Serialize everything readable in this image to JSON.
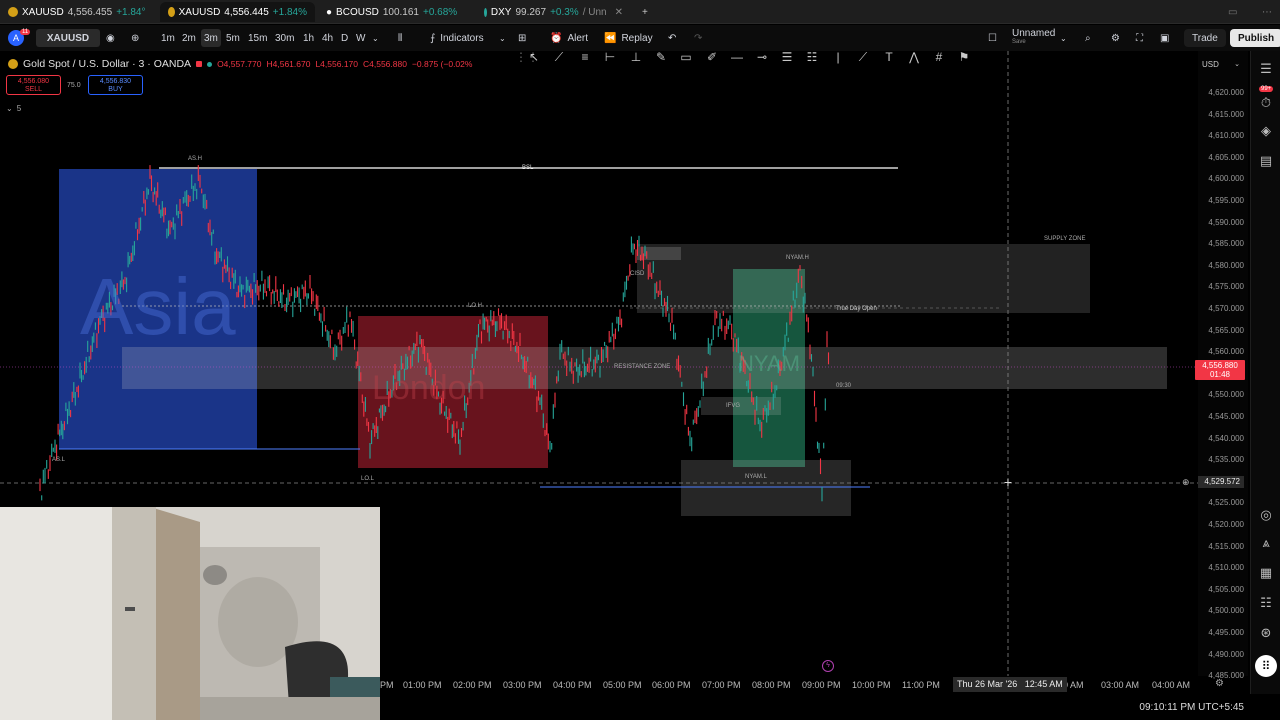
{
  "browser_tabs": [
    {
      "ticker": "XAUUSD",
      "price": "4,556.455",
      "change": "+1.84°",
      "active": false
    },
    {
      "ticker": "XAUUSD",
      "price": "4,556.445",
      "change": "+1.84%",
      "active": true
    },
    {
      "ticker": "BCOUSD",
      "price": "100.161",
      "change": "+0.68%",
      "active": false
    },
    {
      "ticker": "DXY",
      "price": "99.267",
      "change": "+0.3%",
      "suffix": "/ Unn",
      "active": false
    }
  ],
  "toolbar": {
    "avatar_badge": "11",
    "symbol": "XAUUSD",
    "intervals": [
      "1m",
      "2m",
      "3m",
      "5m",
      "15m",
      "30m",
      "1h",
      "4h",
      "D",
      "W"
    ],
    "active_interval": "3m",
    "indicators_label": "Indicators",
    "alert_label": "Alert",
    "replay_label": "Replay",
    "layout_name": "Unnamed",
    "layout_status": "Save",
    "trade_label": "Trade",
    "publish_label": "Publish"
  },
  "legend": {
    "title": "Gold Spot / U.S. Dollar · 3 · OANDA",
    "o": "O4,557.770",
    "h": "H4,561.670",
    "l": "L4,556.170",
    "c": "C4,556.880",
    "chg": "−0.875 (−0.02%",
    "sell_price": "4,556.080",
    "sell_label": "SELL",
    "spread": "75.0",
    "buy_price": "4,556.830",
    "buy_label": "BUY",
    "collapsed_count": "5"
  },
  "currency": "USD",
  "price_labels": [
    "4,620.000",
    "4,615.000",
    "4,610.000",
    "4,605.000",
    "4,600.000",
    "4,595.000",
    "4,590.000",
    "4,585.000",
    "4,580.000",
    "4,575.000",
    "4,570.000",
    "4,565.000",
    "4,560.000",
    "4,555.000",
    "4,550.000",
    "4,545.000",
    "4,540.000",
    "4,535.000",
    "4,530.000",
    "4,525.000",
    "4,520.000",
    "4,515.000",
    "4,510.000",
    "4,505.000",
    "4,500.000",
    "4,495.000",
    "4,490.000",
    "4,485.000"
  ],
  "current_price": {
    "value": "4,556.880",
    "countdown": "01:48",
    "color": "#f23645"
  },
  "crosshair_price": "4,529.572",
  "chart_annotations": {
    "as_h": "AS.H",
    "as_l": "AS.L",
    "bsl": "BSL",
    "lo_h": "LO.H",
    "lo_l": "LO.L",
    "asia": "Asia",
    "london": "London",
    "nyam": "NYAM",
    "nyam_h": "NYAM.H",
    "nyam_l": "NYAM.L",
    "cisd": "CISD",
    "ifvg": "IFVG",
    "resistance": "RESISTANCE ZONE",
    "supply": "SUPPLY ZONE",
    "true_day_open": "True Day Open",
    "time_0930": "09:30"
  },
  "time_labels": [
    "PM",
    "01:00 PM",
    "02:00 PM",
    "03:00 PM",
    "04:00 PM",
    "05:00 PM",
    "06:00 PM",
    "07:00 PM",
    "08:00 PM",
    "09:00 PM",
    "10:00 PM",
    "11:00 PM",
    "0 AM",
    "03:00 AM",
    "04:00 AM"
  ],
  "crosshair_time": "Thu 26 Mar '26   12:45 AM",
  "clock": "09:10:11 PM UTC+5:45",
  "colors": {
    "up": "#26a69a",
    "down": "#f23645",
    "asia": "#1f3fa0",
    "london": "#8a1c26",
    "nyam": "#2a8a63"
  },
  "right_badge": "99+"
}
